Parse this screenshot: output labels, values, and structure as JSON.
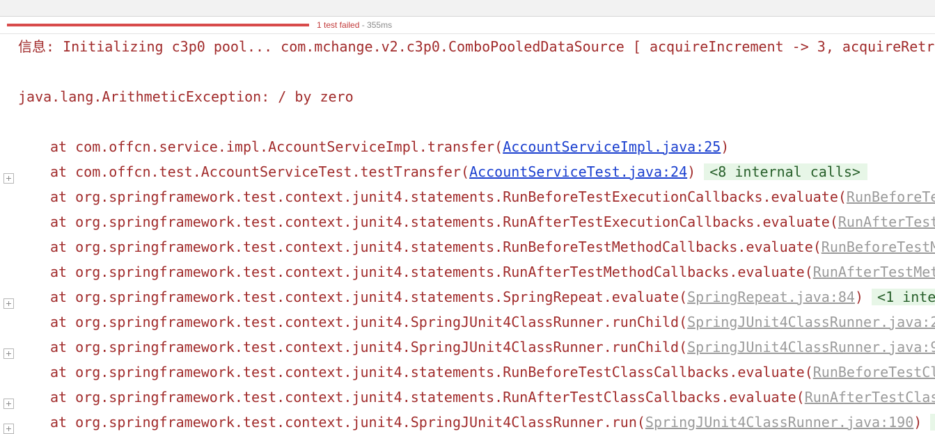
{
  "status": {
    "progress_fraction": 1.0,
    "failed_label": "1 test failed",
    "separator": " - ",
    "duration": "355ms",
    "fail_color": "#d84b4b"
  },
  "console": {
    "info_line": "信息: Initializing c3p0 pool... com.mchange.v2.c3p0.ComboPooledDataSource [ acquireIncrement -> 3, acquireRetr",
    "exception_line": "java.lang.ArithmeticException: / by zero",
    "frames": [
      {
        "prefix": "at com.offcn.service.impl.AccountServiceImpl.transfer(",
        "link": "AccountServiceImpl.java:25",
        "suffix": ")",
        "badge": "",
        "link_style": "blue",
        "expandable": false
      },
      {
        "prefix": "at com.offcn.test.AccountServiceTest.testTransfer(",
        "link": "AccountServiceTest.java:24",
        "suffix": ")",
        "badge": "<8 internal calls>",
        "link_style": "blue",
        "expandable": true
      },
      {
        "prefix": "at org.springframework.test.context.junit4.statements.RunBeforeTestExecutionCallbacks.evaluate(",
        "link": "RunBeforeTe",
        "suffix": "",
        "badge": "",
        "link_style": "grey",
        "expandable": false
      },
      {
        "prefix": "at org.springframework.test.context.junit4.statements.RunAfterTestExecutionCallbacks.evaluate(",
        "link": "RunAfterTest",
        "suffix": "",
        "badge": "",
        "link_style": "grey",
        "expandable": false
      },
      {
        "prefix": "at org.springframework.test.context.junit4.statements.RunBeforeTestMethodCallbacks.evaluate(",
        "link": "RunBeforeTestM",
        "suffix": "",
        "badge": "",
        "link_style": "grey",
        "expandable": false
      },
      {
        "prefix": "at org.springframework.test.context.junit4.statements.RunAfterTestMethodCallbacks.evaluate(",
        "link": "RunAfterTestMet",
        "suffix": "",
        "badge": "",
        "link_style": "grey",
        "expandable": false
      },
      {
        "prefix": "at org.springframework.test.context.junit4.statements.SpringRepeat.evaluate(",
        "link": "SpringRepeat.java:84",
        "suffix": ")",
        "badge": "<1 inte",
        "link_style": "grey",
        "expandable": true
      },
      {
        "prefix": "at org.springframework.test.context.junit4.SpringJUnit4ClassRunner.runChild(",
        "link": "SpringJUnit4ClassRunner.java:2",
        "suffix": "",
        "badge": "",
        "link_style": "grey",
        "expandable": false
      },
      {
        "prefix": "at org.springframework.test.context.junit4.SpringJUnit4ClassRunner.runChild(",
        "link": "SpringJUnit4ClassRunner.java:9",
        "suffix": "",
        "badge": "",
        "link_style": "grey",
        "expandable": true
      },
      {
        "prefix": "at org.springframework.test.context.junit4.statements.RunBeforeTestClassCallbacks.evaluate(",
        "link": "RunBeforeTestCl",
        "suffix": "",
        "badge": "",
        "link_style": "grey",
        "expandable": false
      },
      {
        "prefix": "at org.springframework.test.context.junit4.statements.RunAfterTestClassCallbacks.evaluate(",
        "link": "RunAfterTestClas",
        "suffix": "",
        "badge": "",
        "link_style": "grey",
        "expandable": true
      },
      {
        "prefix": "at org.springframework.test.context.junit4.SpringJUnit4ClassRunner.run(",
        "link": "SpringJUnit4ClassRunner.java:190",
        "suffix": ")",
        "badge": "<",
        "link_style": "grey",
        "expandable": true
      }
    ],
    "icons": {
      "expand": "plus-square-icon"
    }
  }
}
